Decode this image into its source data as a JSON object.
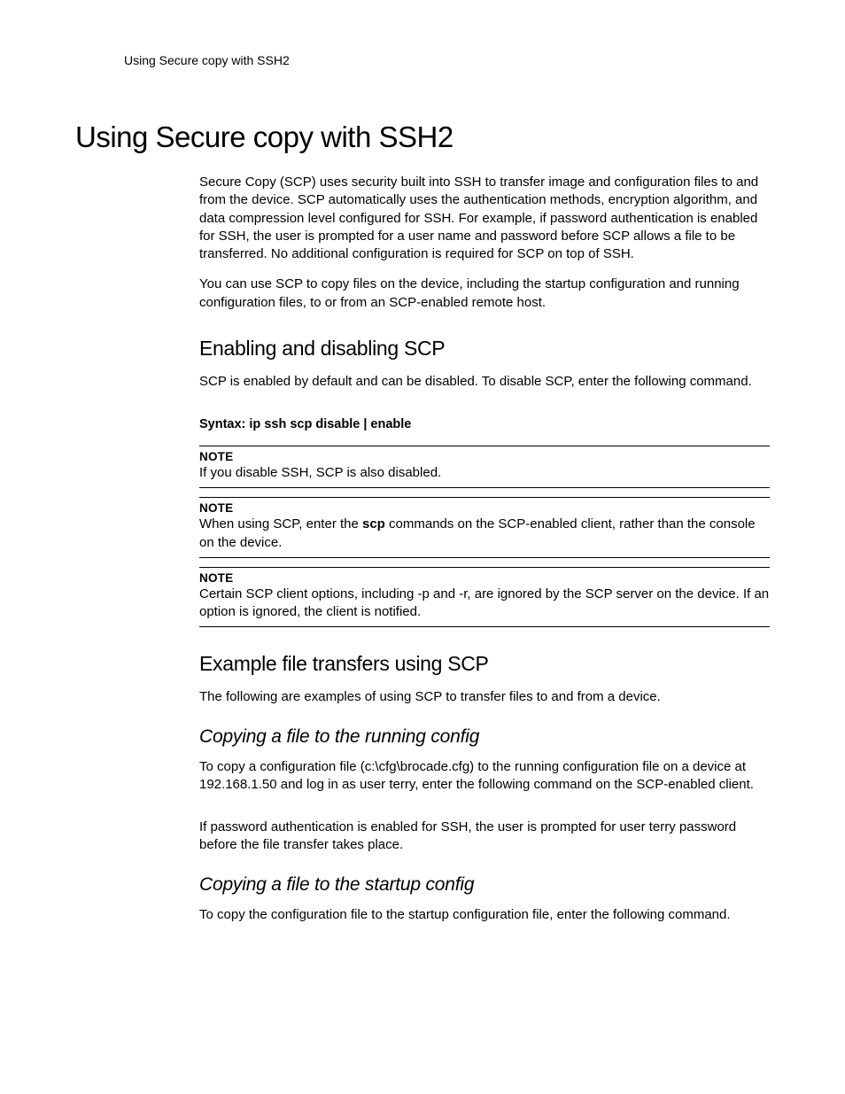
{
  "running_header": "Using Secure copy with SSH2",
  "main_title": "Using Secure copy with SSH2",
  "intro_p1": "Secure Copy (SCP) uses security built into SSH to transfer image and configuration files to and from the device.  SCP automatically uses the authentication methods, encryption algorithm, and data compression level configured for SSH. For example, if password authentication is enabled for SSH, the user is prompted for a user name and password before SCP allows a file to be transferred. No additional configuration is required for SCP on top of SSH.",
  "intro_p2": "You can use SCP to copy files on the device, including the startup configuration and running configuration files, to or from an SCP-enabled remote host.",
  "section1_title": "Enabling and disabling SCP",
  "section1_p1": "SCP is enabled by default and can be disabled. To disable SCP, enter the following command.",
  "syntax_line": "Syntax:  ip ssh scp disable | enable",
  "note_label": "NOTE",
  "note1_text": "If you disable SSH, SCP is also disabled.",
  "note2_pre": "When using SCP, enter the ",
  "note2_bold": "scp",
  "note2_post": " commands on the SCP-enabled client, rather than the console on the device.",
  "note3_text": "Certain SCP client options, including -p and -r, are ignored by the SCP server on the device. If an option is ignored, the client is notified.",
  "section2_title": "Example file transfers using SCP",
  "section2_p1": "The following are examples of using SCP to transfer files to and from a device.",
  "sub1_title": "Copying a file to the running config",
  "sub1_p1": "To copy a configuration file (c:\\cfg\\brocade.cfg) to the running configuration file on a device at 192.168.1.50 and log in as user terry, enter the following command on the SCP-enabled client.",
  "sub1_p2": "If password authentication is enabled for SSH, the user is prompted for user terry password before the file transfer takes place.",
  "sub2_title": "Copying a file to the startup config",
  "sub2_p1": "To copy the configuration file to the startup configuration file, enter the following command."
}
